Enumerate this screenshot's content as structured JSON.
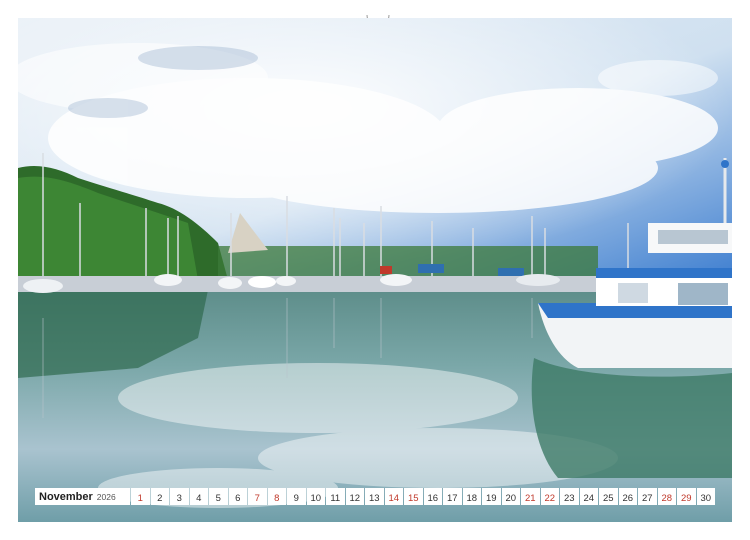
{
  "calendar": {
    "month": "November",
    "year": "2026",
    "weekend_color": "#c0392b",
    "days": [
      {
        "n": "1",
        "weekend": true
      },
      {
        "n": "2",
        "weekend": false
      },
      {
        "n": "3",
        "weekend": false
      },
      {
        "n": "4",
        "weekend": false
      },
      {
        "n": "5",
        "weekend": false
      },
      {
        "n": "6",
        "weekend": false
      },
      {
        "n": "7",
        "weekend": true
      },
      {
        "n": "8",
        "weekend": true
      },
      {
        "n": "9",
        "weekend": false
      },
      {
        "n": "10",
        "weekend": false
      },
      {
        "n": "11",
        "weekend": false
      },
      {
        "n": "12",
        "weekend": false
      },
      {
        "n": "13",
        "weekend": false
      },
      {
        "n": "14",
        "weekend": true
      },
      {
        "n": "15",
        "weekend": true
      },
      {
        "n": "16",
        "weekend": false
      },
      {
        "n": "17",
        "weekend": false
      },
      {
        "n": "18",
        "weekend": false
      },
      {
        "n": "19",
        "weekend": false
      },
      {
        "n": "20",
        "weekend": false
      },
      {
        "n": "21",
        "weekend": true
      },
      {
        "n": "22",
        "weekend": true
      },
      {
        "n": "23",
        "weekend": false
      },
      {
        "n": "24",
        "weekend": false
      },
      {
        "n": "25",
        "weekend": false
      },
      {
        "n": "26",
        "weekend": false
      },
      {
        "n": "27",
        "weekend": false
      },
      {
        "n": "28",
        "weekend": true
      },
      {
        "n": "29",
        "weekend": true
      },
      {
        "n": "30",
        "weekend": false
      }
    ]
  }
}
